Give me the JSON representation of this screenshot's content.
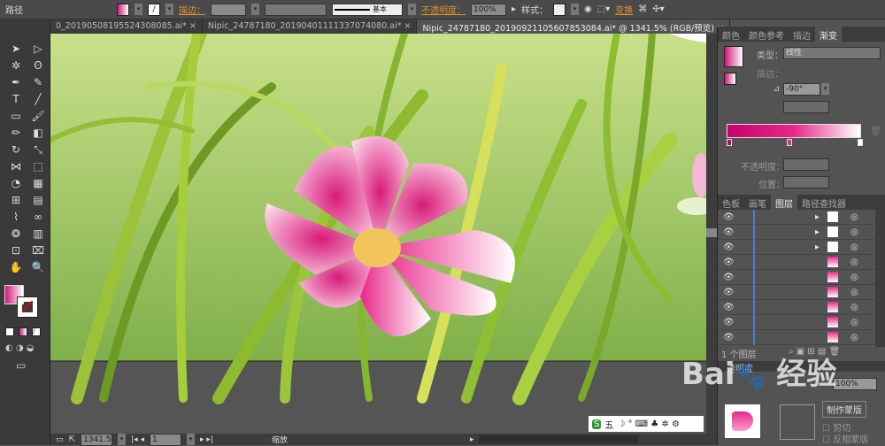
{
  "toolbar": {
    "object_type": "路径",
    "stroke_label": "描边：",
    "stroke_style": "基本",
    "opacity_label": "不透明度：",
    "opacity_value": "100%",
    "style_label": "样式：",
    "transform_label": "变换",
    "fill_color": "#e0308a"
  },
  "tabs": [
    {
      "label": "0_20190508195524308085.ai* ×"
    },
    {
      "label": "Nipic_24787180_20190401111337074080.ai* ×"
    },
    {
      "label": "Nipic_24787180_20190921105607853084.ai* @ 1341.5% (RGB/预览)   ×",
      "active": true
    }
  ],
  "tools": [
    "selection",
    "direct-selection",
    "magic-wand",
    "lasso",
    "pen",
    "curvature",
    "type",
    "line",
    "rectangle",
    "paintbrush",
    "pencil",
    "eraser",
    "rotate",
    "scale",
    "width",
    "free-transform",
    "shape-builder",
    "perspective",
    "mesh",
    "gradient",
    "eyedropper",
    "blend",
    "symbol-sprayer",
    "column-graph",
    "artboard",
    "slice",
    "hand",
    "zoom"
  ],
  "gradient_panel": {
    "tabs": [
      "颜色",
      "颜色参考",
      "描边",
      "渐变"
    ],
    "type_label": "类型：",
    "type_value": "线性",
    "stroke_label": "描边：",
    "angle": "-90°",
    "opacity_label": "不透明度：",
    "position_label": "位置：",
    "stops": [
      "#c8006e",
      "#e8288a",
      "#ffffff"
    ]
  },
  "layers_panel": {
    "tabs": [
      "色板",
      "画笔",
      "图层",
      "路径查找器"
    ],
    "count": "1 个图层",
    "row_count": 9
  },
  "transparency_panel": {
    "title": "透明度",
    "opacity_value": "100%",
    "mask_label": "制作蒙版",
    "clip_label": "剪切",
    "invert_label": "反相蒙版"
  },
  "status": {
    "zoom": "1341.5",
    "artboard": "1",
    "mode": "缩放"
  },
  "ime": {
    "label": "五"
  },
  "watermark": "Baidu 经验 jingyan.baidu.com"
}
